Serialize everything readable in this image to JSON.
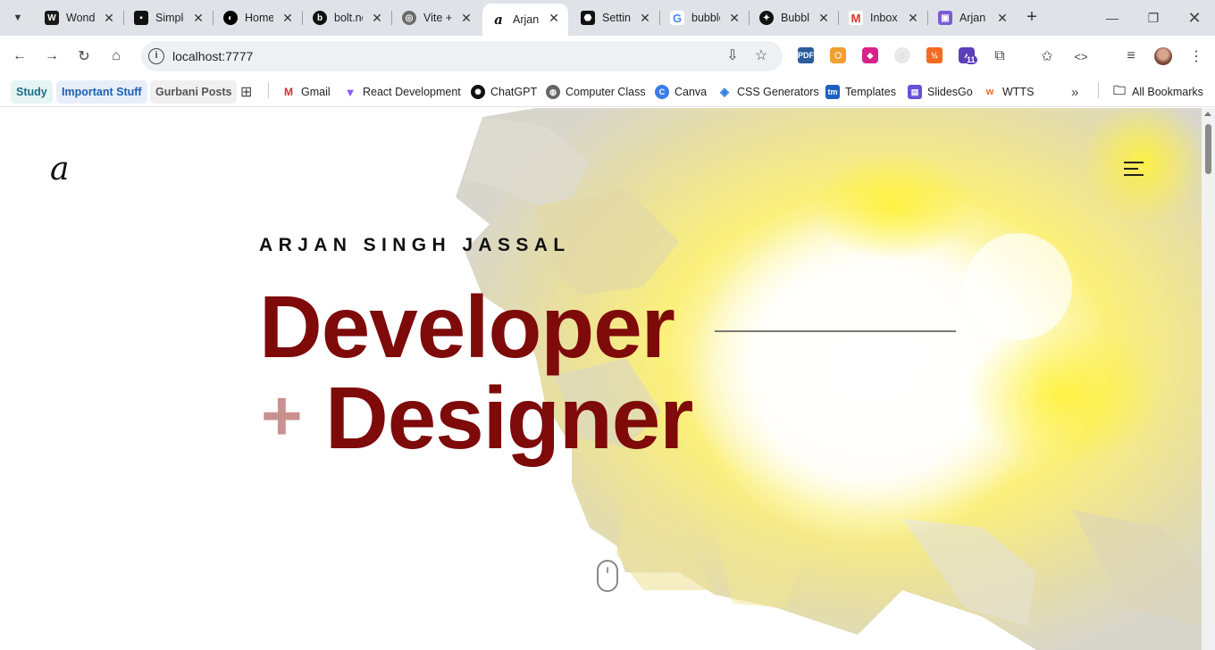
{
  "browser": {
    "tabs": [
      {
        "title": "Wonder",
        "favicon_text": "W",
        "favicon_color": "#1a1a1a"
      },
      {
        "title": "Simple",
        "favicon_text": "▪",
        "favicon_color": "#111111"
      },
      {
        "title": "Home",
        "favicon_text": "◐",
        "favicon_color": "#000000"
      },
      {
        "title": "bolt.new",
        "favicon_text": "b",
        "favicon_color": "#111111"
      },
      {
        "title": "Vite + React",
        "favicon_text": "◎",
        "favicon_color": "#6b6b6b"
      },
      {
        "title": "Arjan",
        "favicon_text": "a",
        "favicon_color": "#ffffff"
      },
      {
        "title": "Settings",
        "favicon_text": "⬣",
        "favicon_color": "#111111"
      },
      {
        "title": "bubble",
        "favicon_text": "G",
        "favicon_color": "#ffffff"
      },
      {
        "title": "Bubble",
        "favicon_text": "✦",
        "favicon_color": "#111111"
      },
      {
        "title": "Inbox",
        "favicon_text": "M",
        "favicon_color": "#ffffff"
      },
      {
        "title": "Arjan",
        "favicon_text": "▣",
        "favicon_color": "#7b5cd6"
      }
    ],
    "active_tab_index": 5,
    "address": "localhost:7777",
    "bookmarks": [
      {
        "label": "Study",
        "style": "chip",
        "color": "#1a6e8a",
        "bg": "#e6f4f4"
      },
      {
        "label": "Important Stuff",
        "style": "chip",
        "color": "#1a5fb4",
        "bg": "#e8eef9"
      },
      {
        "label": "Gurbani Posts",
        "style": "chip",
        "color": "#555555",
        "bg": "#f0f0f0"
      },
      {
        "label": "Gmail",
        "icon": "gmail-icon"
      },
      {
        "label": "React Development",
        "icon": "vite-icon"
      },
      {
        "label": "ChatGPT",
        "icon": "openai-icon"
      },
      {
        "label": "Computer Class",
        "icon": "globe-icon"
      },
      {
        "label": "Canva",
        "icon": "canva-icon"
      },
      {
        "label": "CSS Generators",
        "icon": "layers-icon"
      },
      {
        "label": "Templates",
        "icon": "tm-icon"
      },
      {
        "label": "SlidesGo",
        "icon": "slidesgo-icon"
      },
      {
        "label": "WTTS",
        "icon": "wtts-icon"
      }
    ],
    "all_bookmarks_label": "All Bookmarks",
    "extension_badge": "11"
  },
  "site": {
    "logo": "a",
    "name": "ARJAN SINGH JASSAL",
    "headline_line1": "Developer",
    "headline_plus": "+",
    "headline_line2": "Designer",
    "colors": {
      "accent": "#7e0a0a",
      "plus": "#c99090"
    }
  }
}
